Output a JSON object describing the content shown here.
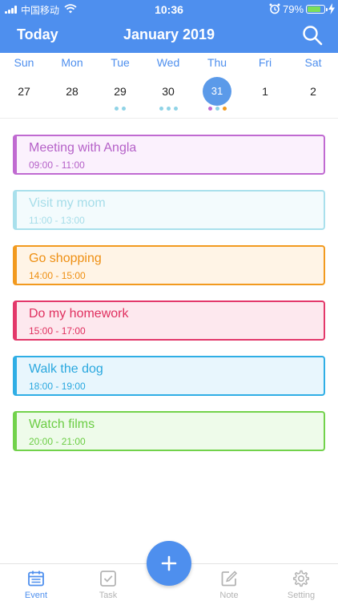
{
  "status_bar": {
    "carrier": "中国移动",
    "time": "10:36",
    "battery_percent": "79%",
    "battery_level": 0.79,
    "battery_color": "#7cdf5a"
  },
  "header": {
    "today_label": "Today",
    "title": "January 2019",
    "search_icon": "search-icon",
    "background_color": "#4e8fee"
  },
  "week": {
    "days": [
      {
        "weekday": "Sun",
        "date": "27",
        "selected": false,
        "dots": []
      },
      {
        "weekday": "Mon",
        "date": "28",
        "selected": false,
        "dots": []
      },
      {
        "weekday": "Tue",
        "date": "29",
        "selected": false,
        "dots": [
          "#8fd3e6",
          "#8fd3e6"
        ]
      },
      {
        "weekday": "Wed",
        "date": "30",
        "selected": false,
        "dots": [
          "#8fd3e6",
          "#8fd3e6",
          "#8fd3e6"
        ]
      },
      {
        "weekday": "Thu",
        "date": "31",
        "selected": true,
        "dots": [
          "#c06ad1",
          "#8fd3e6",
          "#f29a1f"
        ]
      },
      {
        "weekday": "Fri",
        "date": "1",
        "selected": false,
        "dots": []
      },
      {
        "weekday": "Sat",
        "date": "2",
        "selected": false,
        "dots": []
      }
    ]
  },
  "events": [
    {
      "title": "Meeting with Angla",
      "time": "09:00 - 11:00",
      "text_color": "#b561c8",
      "border_color": "#c06ad1",
      "bg_color": "#fbf1fd"
    },
    {
      "title": "Visit my mom",
      "time": "11:00 - 13:00",
      "text_color": "#a6dde9",
      "border_color": "#a9e0ec",
      "bg_color": "#f3fbfd"
    },
    {
      "title": "Go shopping",
      "time": "14:00 - 15:00",
      "text_color": "#ee8f12",
      "border_color": "#f29a1f",
      "bg_color": "#fff4e6"
    },
    {
      "title": "Do my homework",
      "time": "15:00 - 17:00",
      "text_color": "#e0305f",
      "border_color": "#e3386a",
      "bg_color": "#fde8ee"
    },
    {
      "title": "Walk the dog",
      "time": "18:00 - 19:00",
      "text_color": "#2aa8df",
      "border_color": "#2faee5",
      "bg_color": "#e8f6fd"
    },
    {
      "title": "Watch films",
      "time": "20:00 - 21:00",
      "text_color": "#6ccd45",
      "border_color": "#72d24b",
      "bg_color": "#eefbea"
    }
  ],
  "tabbar": {
    "tabs": [
      {
        "label": "Event",
        "icon": "calendar-icon",
        "active": true
      },
      {
        "label": "Task",
        "icon": "checkbox-icon",
        "active": false
      },
      {
        "label": "Note",
        "icon": "edit-icon",
        "active": false
      },
      {
        "label": "Setting",
        "icon": "gear-icon",
        "active": false
      }
    ],
    "add_icon": "plus-icon"
  }
}
